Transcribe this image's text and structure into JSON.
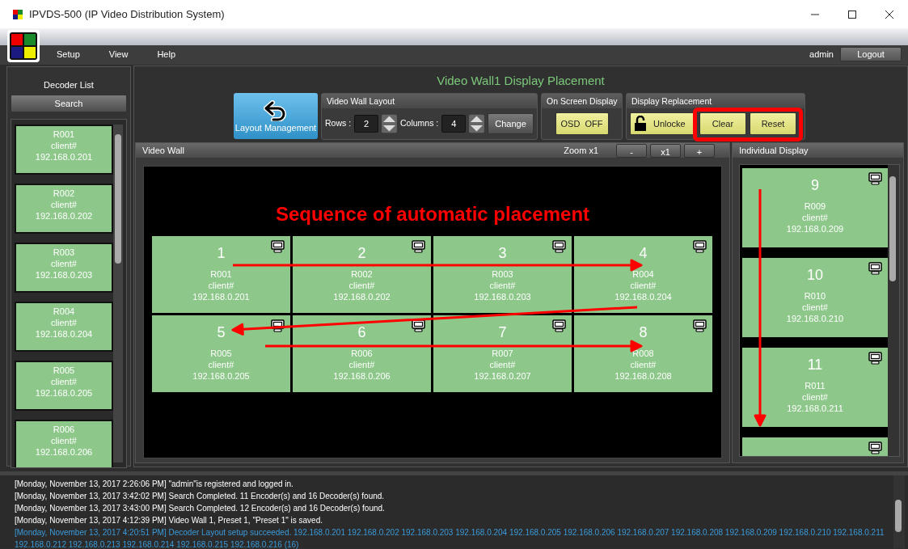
{
  "window": {
    "title": "IPVDS-500 (IP Video Distribution System)"
  },
  "menu": [
    {
      "label": "Setup"
    },
    {
      "label": "View"
    },
    {
      "label": "Help"
    }
  ],
  "user": "admin",
  "logout": "Logout",
  "decoder_list": {
    "title": "Decoder List",
    "search": "Search",
    "items": [
      {
        "name": "R001",
        "client": "client#",
        "ip": "192.168.0.201"
      },
      {
        "name": "R002",
        "client": "client#",
        "ip": "192.168.0.202"
      },
      {
        "name": "R003",
        "client": "client#",
        "ip": "192.168.0.203"
      },
      {
        "name": "R004",
        "client": "client#",
        "ip": "192.168.0.204"
      },
      {
        "name": "R005",
        "client": "client#",
        "ip": "192.168.0.205"
      },
      {
        "name": "R006",
        "client": "client#",
        "ip": "192.168.0.206"
      }
    ]
  },
  "title": "Video Wall1 Display Placement",
  "layout_management": "Layout Management",
  "video_wall_layout": {
    "title": "Video Wall Layout",
    "rows_label": "Rows :",
    "rows": "2",
    "columns_label": "Columns :",
    "columns": "4",
    "change": "Change"
  },
  "on_screen_display": {
    "title": "On Screen Display",
    "button": "OSD  OFF"
  },
  "display_replacement": {
    "title": "Display Replacement",
    "lock": "Unlocke",
    "clear": "Clear",
    "reset": "Reset"
  },
  "video_wall": {
    "title": "Video Wall",
    "zoom": "Zoom x1",
    "zoom_buttons": [
      "-",
      "x1",
      "+"
    ],
    "annotation": "Sequence of automatic placement",
    "cells": [
      {
        "number": "1",
        "name": "R001",
        "client": "client#",
        "ip": "192.168.0.201"
      },
      {
        "number": "2",
        "name": "R002",
        "client": "client#",
        "ip": "192.168.0.202"
      },
      {
        "number": "3",
        "name": "R003",
        "client": "client#",
        "ip": "192.168.0.203"
      },
      {
        "number": "4",
        "name": "R004",
        "client": "client#",
        "ip": "192.168.0.204"
      },
      {
        "number": "5",
        "name": "R005",
        "client": "client#",
        "ip": "192.168.0.205"
      },
      {
        "number": "6",
        "name": "R006",
        "client": "client#",
        "ip": "192.168.0.206"
      },
      {
        "number": "7",
        "name": "R007",
        "client": "client#",
        "ip": "192.168.0.207"
      },
      {
        "number": "8",
        "name": "R008",
        "client": "client#",
        "ip": "192.168.0.208"
      }
    ]
  },
  "individual_display": {
    "title": "Individual Display",
    "cells": [
      {
        "number": "9",
        "name": "R009",
        "client": "client#",
        "ip": "192.168.0.209"
      },
      {
        "number": "10",
        "name": "R010",
        "client": "client#",
        "ip": "192.168.0.210"
      },
      {
        "number": "11",
        "name": "R011",
        "client": "client#",
        "ip": "192.168.0.211"
      },
      {}
    ]
  },
  "log": [
    {
      "kind": "normal",
      "text": "[Monday, November 13, 2017 2:26:06 PM] \"admin\"is registered and logged in."
    },
    {
      "kind": "normal",
      "text": "[Monday, November 13, 2017 3:42:02 PM] Search Completed. 11 Encoder(s) and 16 Decoder(s) found."
    },
    {
      "kind": "normal",
      "text": "[Monday, November 13, 2017 3:43:00 PM] Search Completed. 12 Encoder(s) and 16 Decoder(s) found."
    },
    {
      "kind": "normal",
      "text": "[Monday, November 13, 2017 4:12:39 PM] Video Wall 1, Preset 1, \"Preset 1\" is saved."
    },
    {
      "kind": "highlight",
      "text": "[Monday, November 13, 2017 4:20:51 PM] Decoder Layout setup succeeded. 192.168.0.201 192.168.0.202 192.168.0.203 192.168.0.204 192.168.0.205 192.168.0.206 192.168.0.207 192.168.0.208 192.168.0.209 192.168.0.210 192.168.0.211 192.168.0.212 192.168.0.213 192.168.0.214 192.168.0.215 192.168.0.216 (16)"
    }
  ]
}
